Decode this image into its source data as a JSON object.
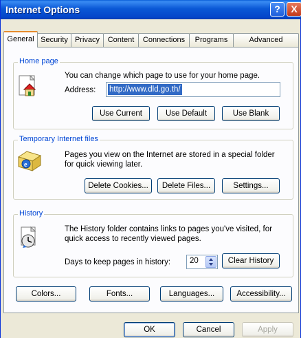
{
  "window": {
    "title": "Internet Options"
  },
  "titlebar": {
    "help_label": "?",
    "close_label": "X"
  },
  "tabs": [
    {
      "label": "General",
      "active": true
    },
    {
      "label": "Security"
    },
    {
      "label": "Privacy"
    },
    {
      "label": "Content"
    },
    {
      "label": "Connections"
    },
    {
      "label": "Programs"
    },
    {
      "label": "Advanced"
    }
  ],
  "home_page": {
    "group_label": "Home page",
    "description": "You can change which page to use for your home page.",
    "address_label": "Address:",
    "address_value": "http://www.dld.go.th/",
    "use_current": "Use Current",
    "use_default": "Use Default",
    "use_blank": "Use Blank",
    "icon": "home-icon"
  },
  "temp_files": {
    "group_label": "Temporary Internet files",
    "description_1": "Pages you view on the Internet are stored in a special folder",
    "description_2": "for quick viewing later.",
    "delete_cookies": "Delete Cookies...",
    "delete_files": "Delete Files...",
    "settings": "Settings...",
    "icon": "folder-ie-icon"
  },
  "history": {
    "group_label": "History",
    "description_1": "The History folder contains links to pages you've visited, for",
    "description_2": "quick access to recently viewed pages.",
    "days_label": "Days to keep pages in history:",
    "days_value": "20",
    "clear_history": "Clear History",
    "icon": "history-clock-icon"
  },
  "bottom_buttons": {
    "colors": "Colors...",
    "fonts": "Fonts...",
    "languages": "Languages...",
    "accessibility": "Accessibility..."
  },
  "dialog_buttons": {
    "ok": "OK",
    "cancel": "Cancel",
    "apply": "Apply"
  },
  "colors": {
    "titlebar": "#0a58d6",
    "group_label": "#0046d5",
    "selection": "#316ac5",
    "dialog_bg": "#ece9d8"
  }
}
